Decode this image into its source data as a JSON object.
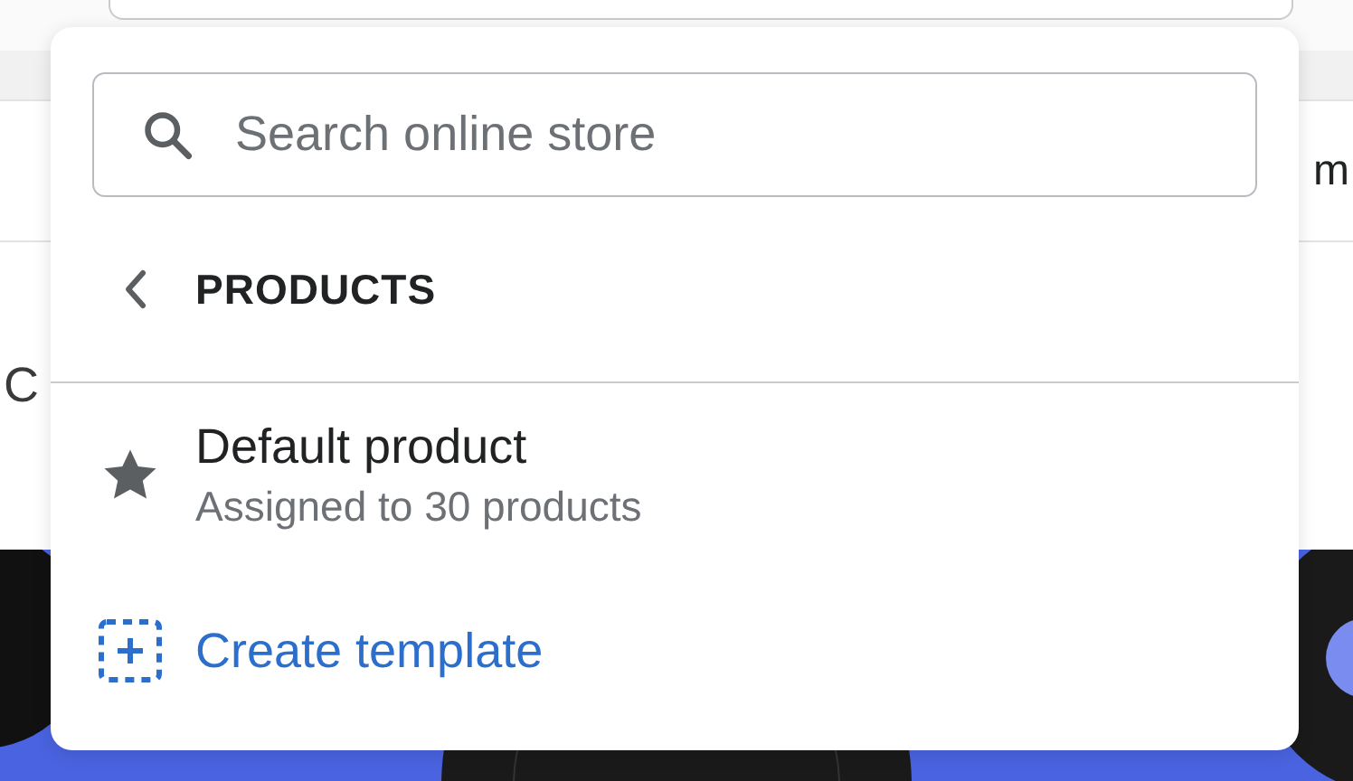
{
  "background": {
    "left_text": "C",
    "right_text": "m"
  },
  "popover": {
    "search": {
      "placeholder": "Search online store"
    },
    "header": {
      "title": "PRODUCTS"
    },
    "templates": [
      {
        "title": "Default product",
        "subtitle": "Assigned to 30 products"
      }
    ],
    "action": {
      "label": "Create template"
    }
  }
}
